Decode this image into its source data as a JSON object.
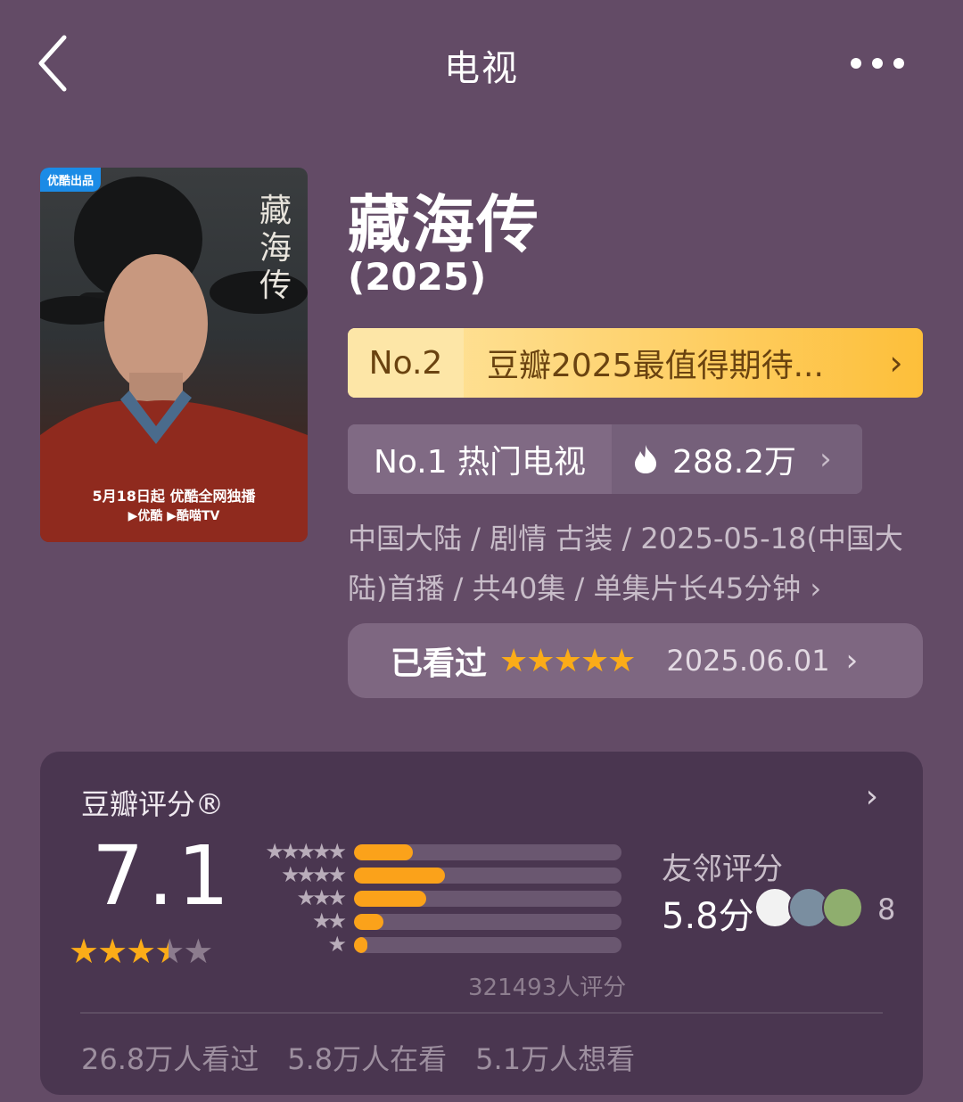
{
  "header": {
    "title": "电视"
  },
  "poster": {
    "badge": "优酷出品",
    "vertical_title": "藏海传",
    "release_line": "5月18日起 优酷全网独播",
    "platform_line": "▶优酷  ▶酷喵TV"
  },
  "show": {
    "name": "藏海传",
    "year": "(2025)"
  },
  "rank_list": {
    "no": "No.2",
    "text": "豆瓣2025最值得期待...",
    "chevron": "›"
  },
  "hot_rank": {
    "label": "No.1 热门电视",
    "count": "288.2万"
  },
  "meta": "中国大陆 / 剧情 古装 / 2025-05-18(中国大陆)首播 / 共40集 / 单集片长45分钟 ›",
  "watched": {
    "status": "已看过",
    "stars": 5,
    "date": "2025.06.01"
  },
  "rating": {
    "title": "豆瓣评分®",
    "score": "7.1",
    "star_rating": 3.5,
    "distribution": [
      {
        "stars": 5,
        "fraction": 0.22
      },
      {
        "stars": 4,
        "fraction": 0.34
      },
      {
        "stars": 3,
        "fraction": 0.27
      },
      {
        "stars": 2,
        "fraction": 0.11
      },
      {
        "stars": 1,
        "fraction": 0.05
      }
    ],
    "count_text": "321493人评分",
    "friends_label": "友邻评分",
    "friends_score": "5.8分",
    "friends_count": "8",
    "stats": [
      "26.8万人看过",
      "5.8万人在看",
      "5.1万人想看"
    ]
  },
  "colors": {
    "accent_star": "#fbac18",
    "background": "#634b66",
    "card": "#4a3650"
  }
}
